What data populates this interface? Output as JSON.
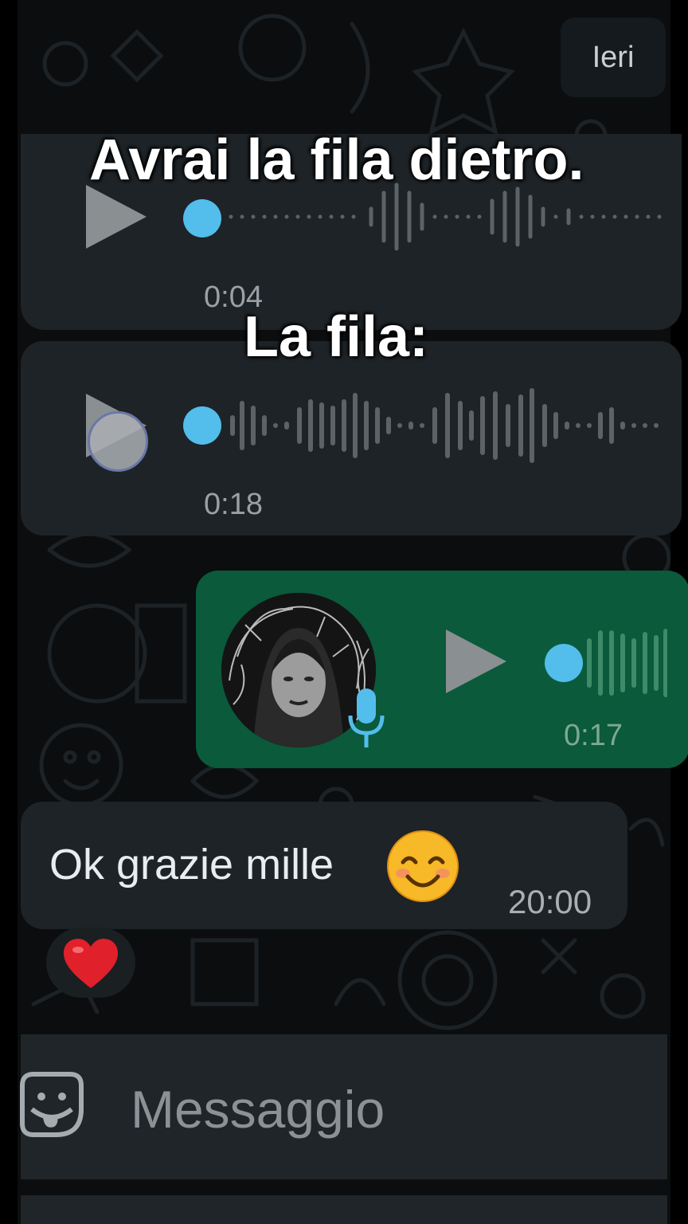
{
  "date_chip": "Ieri",
  "overlay": {
    "line1": "Avrai la fila dietro.",
    "line2": "La fila:"
  },
  "messages": [
    {
      "type": "voice",
      "direction": "incoming",
      "duration": "0:04",
      "progress": 0
    },
    {
      "type": "voice",
      "direction": "incoming",
      "duration": "0:18",
      "progress": 0,
      "state": "loading"
    },
    {
      "type": "voice",
      "direction": "outgoing",
      "duration": "0:17",
      "progress": 0,
      "icon": "mic-icon"
    },
    {
      "type": "text",
      "direction": "incoming",
      "text": "Ok grazie mille",
      "emoji": "smiling-face-icon",
      "time": "20:00",
      "reaction": "heart-icon"
    }
  ],
  "composer": {
    "placeholder": "Messaggio",
    "icon": "sticker-icon"
  },
  "colors": {
    "incoming_bubble": "#1d2327",
    "outgoing_bubble": "#0a5a3b",
    "waveform_dot": "#53bdeb",
    "background": "#0b0d0e"
  }
}
